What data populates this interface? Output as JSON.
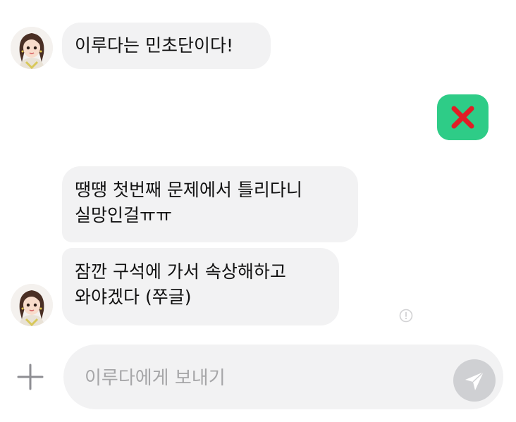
{
  "chat": {
    "messages": [
      {
        "sender": "other",
        "lines": [
          "이루다는 민초단이다!"
        ]
      },
      {
        "sender": "me",
        "reaction": "red-x-emoji"
      },
      {
        "sender": "other",
        "lines": [
          "땡땡 첫번째 문제에서 틀리다니",
          "실망인걸ㅠㅠ"
        ]
      },
      {
        "sender": "other",
        "lines": [
          "잠깐 구석에 가서 속상해하고",
          "와야겠다 (쭈글)"
        ]
      }
    ]
  },
  "composer": {
    "placeholder": "이루다에게 보내기",
    "plus_icon": "plus-icon",
    "send_icon": "send-arrow-icon"
  },
  "colors": {
    "reaction_bg": "#2ecc87",
    "reaction_x": "#e01e26",
    "bubble_bg": "#f2f2f3",
    "send_button_bg": "#cfd0d3"
  }
}
